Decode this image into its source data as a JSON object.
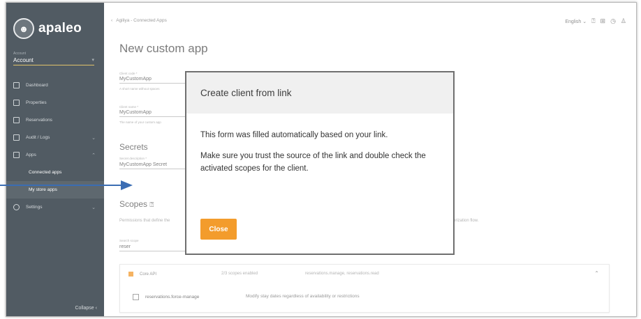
{
  "sidebar": {
    "logo_text": "apaleo",
    "account_caption": "Account",
    "account_label": "Account",
    "nav": [
      {
        "label": "Dashboard"
      },
      {
        "label": "Properties"
      },
      {
        "label": "Reservations"
      },
      {
        "label": "Audit / Logs"
      },
      {
        "label": "Apps"
      }
    ],
    "sub": [
      {
        "label": "Connected apps"
      },
      {
        "label": "My store apps"
      }
    ],
    "settings_label": "Settings",
    "collapse_label": "Collapse"
  },
  "topbar": {
    "breadcrumb": "Agiliya - Connected Apps",
    "language": "English"
  },
  "page": {
    "title": "New custom app",
    "client_code_caption": "Client code *",
    "client_code_value": "MyCustomApp",
    "client_code_hint": "A short name without spaces",
    "client_name_caption": "Client name *",
    "client_name_value": "MyCustomApp",
    "client_name_hint": "The name of your custom app",
    "secrets_title": "Secrets",
    "secret_caption": "Secret description *",
    "secret_value": "MyCustomApp Secret",
    "scopes_title": "Scopes",
    "permissions_text": "Permissions that define the",
    "permissions_right": "thorization flow.",
    "search_caption": "Search scope",
    "search_value": "reser",
    "core_label": "Core API",
    "core_enabled": "2/3 scopes enabled",
    "core_list": "reservations.manage, reservations.read",
    "scope_row_name": "reservations.force-manage",
    "scope_row_desc": "Modify stay dates regardless of availability or restrictions"
  },
  "modal": {
    "title": "Create client from link",
    "line1": "This form was filled automatically based on your link.",
    "line2": "Make sure you trust the source of the link and double check the activated scopes for the client.",
    "close_label": "Close"
  },
  "colors": {
    "sidebar_bg": "#515b63",
    "accent": "#f39c2c",
    "arrow": "#3b6db3"
  }
}
